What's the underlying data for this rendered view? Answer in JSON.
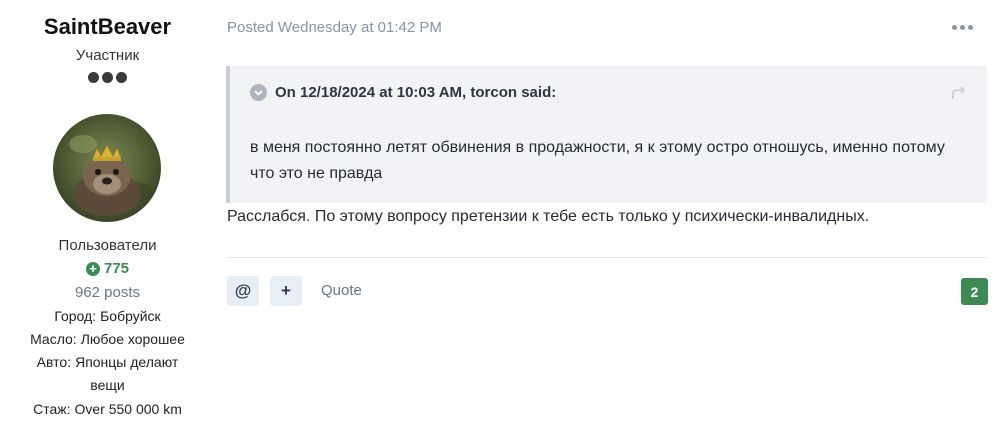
{
  "author": {
    "name": "SaintBeaver",
    "rank": "Участник",
    "group": "Пользователи",
    "reputation": "775",
    "posts": "962 posts",
    "fields": [
      {
        "key": "Город:",
        "value": "Бобруйск"
      },
      {
        "key": "Масло:",
        "value": "Любое хорошее"
      },
      {
        "key": "Авто:",
        "value": "Японцы делают",
        "value2": "вещи"
      },
      {
        "key": "Стаж:",
        "value": "Over 550 000 km"
      }
    ]
  },
  "post": {
    "posted": "Posted Wednesday at 01:42 PM",
    "quote": {
      "header": "On 12/18/2024 at 10:03 AM, torcon said:",
      "text": "в меня постоянно летят обвинения в продажности, я к этому остро отношусь, именно потому что это не правда"
    },
    "body": "Расслабся. По этому вопросу претензии к тебе есть только у психически-инвалидных.",
    "actions": {
      "mention": "@",
      "add": "+",
      "quote": "Quote",
      "reaction_count": "2"
    }
  },
  "colors": {
    "accent_green": "#3e8a57",
    "quote_bg": "#f1f3f6",
    "muted": "#8a93a0"
  }
}
